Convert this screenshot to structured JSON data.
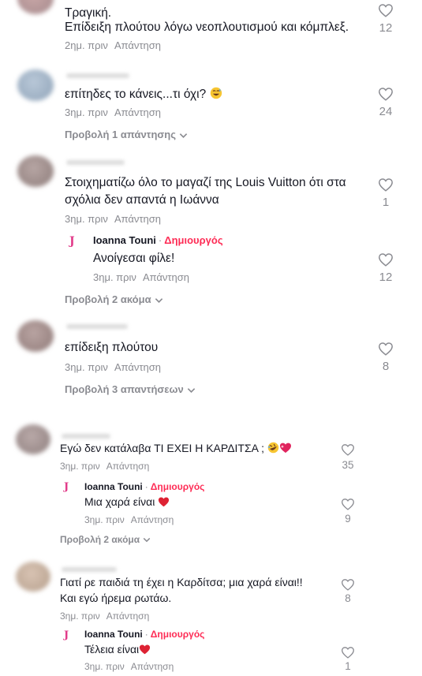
{
  "comments": [
    {
      "lines": [
        "Τραγική.",
        "Επίδειξη πλούτου λόγω νεοπλουτισμού και κόμπλεξ."
      ],
      "time": "2ημ. πριν",
      "reply": "Απάντηση",
      "likes": "12"
    },
    {
      "lines": [
        "επίτηδες το κάνεις...τι όχι?"
      ],
      "time": "3ημ. πριν",
      "reply": "Απάντηση",
      "likes": "24",
      "more": "Προβολή 1 απάντησης"
    },
    {
      "lines": [
        "Στοιχηματίζω όλο το μαγαζί της Louis Vuitton ότι στα",
        "σχόλια δεν απαντά η Ιωάννα"
      ],
      "time": "3ημ. πριν",
      "reply": "Απάντηση",
      "likes": "1",
      "creator_reply": {
        "author": "Ioanna Touni",
        "role": "Δημιουργός",
        "text": "Ανοίγεσαι φίλε!",
        "time": "3ημ. πριν",
        "reply": "Απάντηση",
        "likes": "12"
      },
      "more": "Προβολή 2 ακόμα"
    },
    {
      "lines": [
        "επίδειξη πλούτου"
      ],
      "time": "3ημ. πριν",
      "reply": "Απάντηση",
      "likes": "8",
      "more": "Προβολή 3 απαντήσεων"
    },
    {
      "lines": [
        "Εγώ δεν κατάλαβα ΤΙ ΕΧΕΙ Η ΚΑΡΔΙΤΣΑ ;"
      ],
      "time": "3ημ. πριν",
      "reply": "Απάντηση",
      "likes": "35",
      "creator_reply": {
        "author": "Ioanna Touni",
        "role": "Δημιουργός",
        "text": "Μια χαρά είναι",
        "time": "3ημ. πριν",
        "reply": "Απάντηση",
        "likes": "9"
      },
      "more": "Προβολή 2 ακόμα"
    },
    {
      "lines": [
        "Γιατί ρε παιδιά τη έχει η Καρδίτσα; μια χαρά είναι!!",
        "Και εγώ ήρεμα ρωτάω."
      ],
      "time": "3ημ. πριν",
      "reply": "Απάντηση",
      "likes": "8",
      "creator_reply": {
        "author": "Ioanna Touni",
        "role": "Δημιουργός",
        "text": "Τέλεια είναι",
        "time": "3ημ. πριν",
        "reply": "Απάντηση",
        "likes": "1"
      }
    }
  ],
  "creator_logo": "J",
  "separator": "·",
  "icons": {
    "like": "heart-outline-icon",
    "expand": "chevron-down-icon",
    "emoji_laugh": "grinning-sweat-emoji",
    "emoji_laugh2": "rolling-laugh-emoji",
    "emoji_heart": "red-heart-emoji",
    "emoji_heart_sparkle": "sparkling-heart-emoji"
  },
  "colors": {
    "creator": "#fe2c55",
    "meta": "#8a8b91",
    "text": "#161823",
    "heart_emoji": "#e0245e"
  }
}
